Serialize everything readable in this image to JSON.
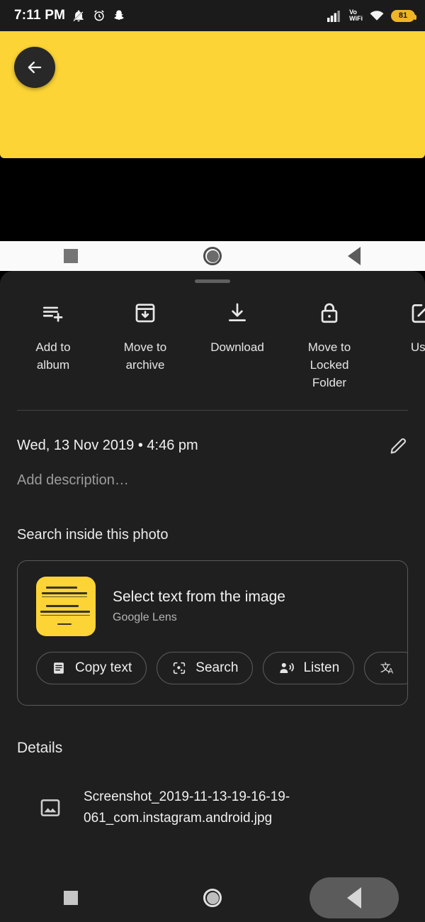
{
  "status_bar": {
    "time": "7:11 PM",
    "icons_left": [
      "bell-muted-icon",
      "alarm-clock-icon",
      "snapchat-icon"
    ],
    "icons_right": [
      "signal-bars-icon",
      "vowifi-icon",
      "wifi-icon",
      "battery-icon"
    ],
    "vowifi_line1": "Vo",
    "vowifi_line2": "WiFi",
    "battery_level": "81",
    "battery_color": "#f0b429"
  },
  "photo": {
    "background_color": "#fcd436",
    "back_button": "back-arrow-icon"
  },
  "system_nav_behind": {
    "recents": "square-icon",
    "home": "circle-icon",
    "back": "triangle-back-icon"
  },
  "sheet": {
    "handle": "drag-handle",
    "actions": [
      {
        "icon": "playlist-add-icon",
        "label": "Add to\nalbum",
        "label_lines": [
          "Add to",
          "album"
        ]
      },
      {
        "icon": "archive-icon",
        "label": "Move to\narchive",
        "label_lines": [
          "Move to",
          "archive"
        ]
      },
      {
        "icon": "download-icon",
        "label": "Download",
        "label_lines": [
          "Download"
        ]
      },
      {
        "icon": "lock-icon",
        "label": "Move to\nLocked\nFolder",
        "label_lines": [
          "Move to",
          "Locked",
          "Folder"
        ]
      },
      {
        "icon": "edit-square-icon",
        "label": "Use",
        "label_lines": [
          "Use"
        ]
      }
    ],
    "date": "Wed, 13 Nov 2019  •  4:46 pm",
    "edit_icon": "pencil-icon",
    "description_placeholder": "Add description…",
    "search_section_title": "Search inside this photo",
    "lens_card": {
      "thumbnail": "yellow-note-thumbnail",
      "title": "Select text from the image",
      "subtitle": "Google Lens",
      "chips": [
        {
          "icon": "copy-text-icon",
          "label": "Copy text"
        },
        {
          "icon": "lens-search-icon",
          "label": "Search"
        },
        {
          "icon": "listen-icon",
          "label": "Listen"
        },
        {
          "icon": "translate-icon",
          "label": ""
        }
      ]
    },
    "details_title": "Details",
    "file": {
      "icon": "image-file-icon",
      "name": "Screenshot_2019-11-13-19-16-19-061_com.instagram.android.jpg"
    }
  },
  "bottom_nav": {
    "recents": "square-icon",
    "home": "circle-icon",
    "back": "triangle-back-icon"
  }
}
